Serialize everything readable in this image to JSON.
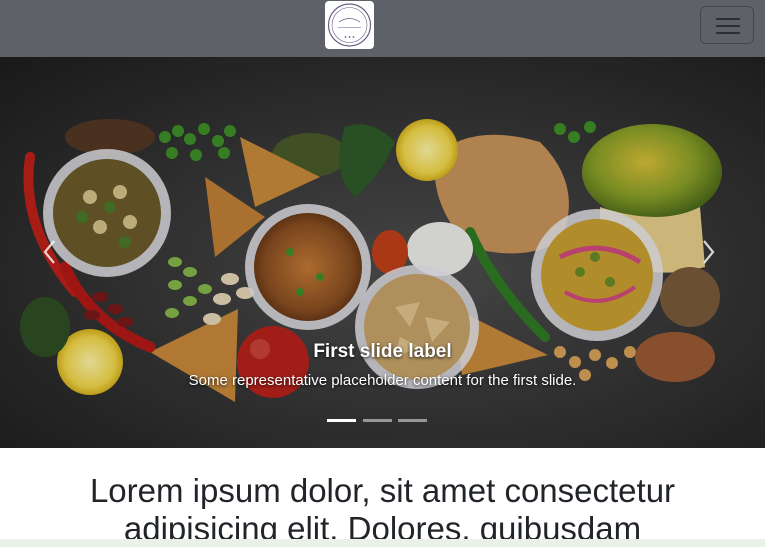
{
  "navbar": {
    "logo_name": "vaje's khaanaa",
    "logo_tagline": "SINCE 2020",
    "toggler_icon": "hamburger-icon",
    "background": "#5e6268"
  },
  "carousel": {
    "slides": [
      {
        "title": "First slide label",
        "text": "Some representative placeholder content for the first slide."
      }
    ],
    "indicator_count": 3,
    "active_index": 0,
    "prev_icon": "chevron-left-icon",
    "next_icon": "chevron-right-icon"
  },
  "main": {
    "heading": "Lorem ipsum dolor, sit amet consectetur adipisicing elit. Dolores, quibusdam"
  }
}
